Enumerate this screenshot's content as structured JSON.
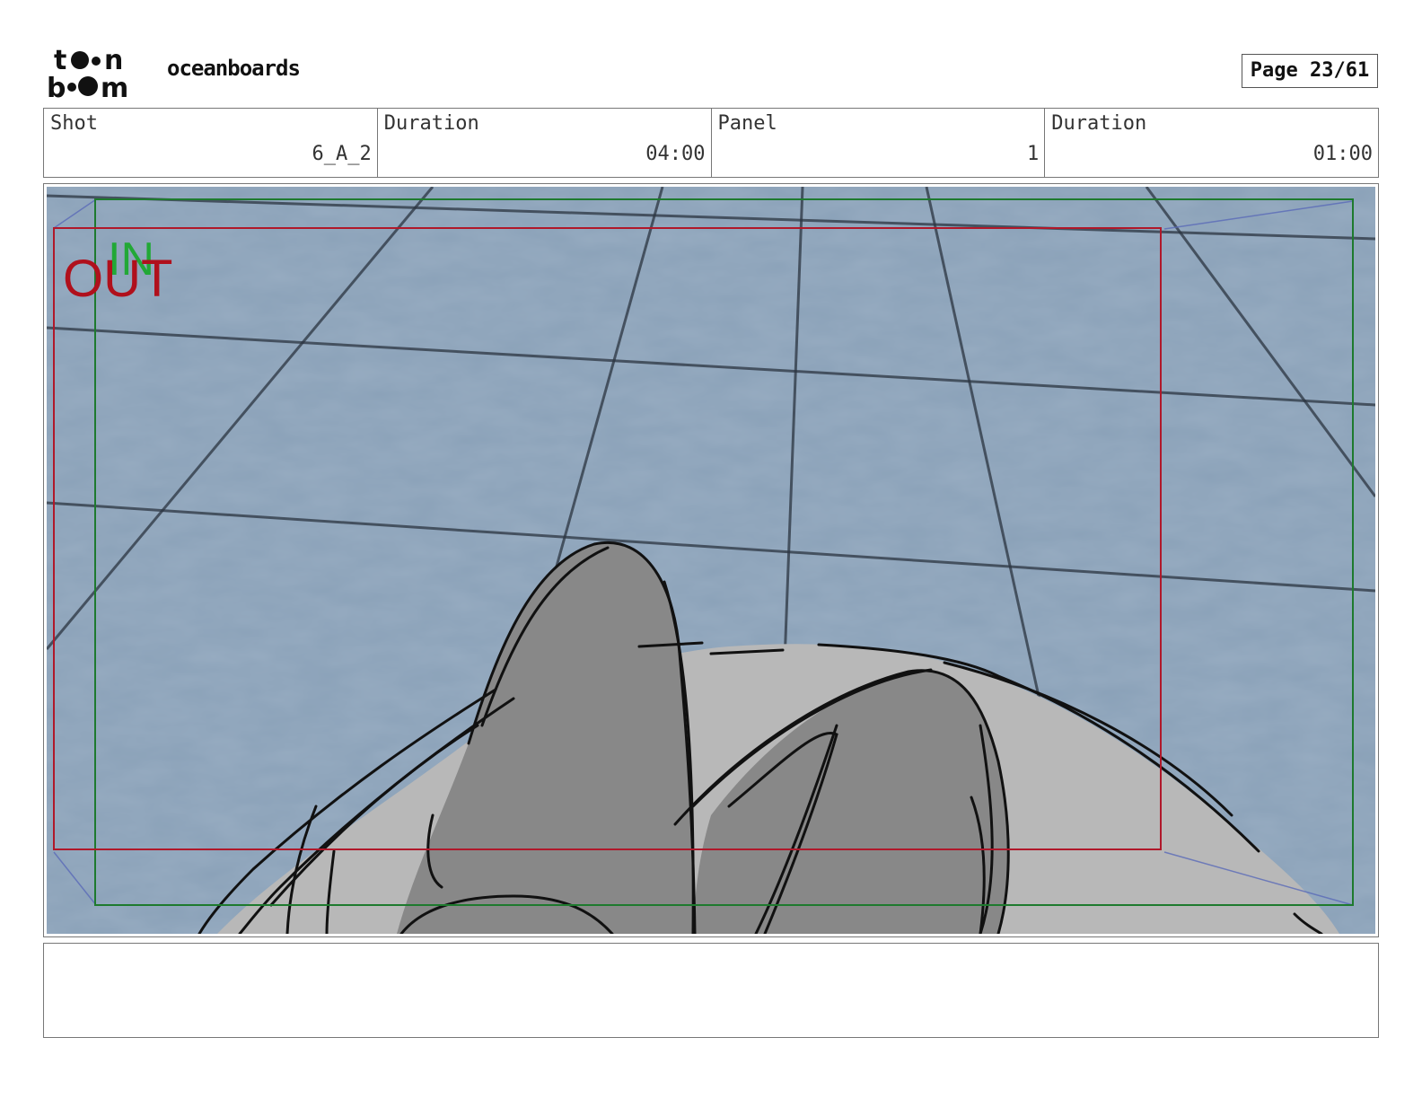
{
  "header": {
    "logo_text": "toonboom",
    "project_name": "oceanboards",
    "page_label": "Page 23/61"
  },
  "info": {
    "shot": {
      "label": "Shot",
      "value": "6_A_2"
    },
    "shot_duration": {
      "label": "Duration",
      "value": "04:00"
    },
    "panel": {
      "label": "Panel",
      "value": "1"
    },
    "panel_duration": {
      "label": "Duration",
      "value": "01:00"
    }
  },
  "panel_image": {
    "in_marker": "IN",
    "out_marker": "OUT",
    "colors": {
      "water": "#7f97b0",
      "grid": "#2b3440",
      "in_frame": "#1e7a2e",
      "out_frame": "#b0182a",
      "sketch_dark": "#8a8a8a",
      "sketch_light": "#b8b8b8",
      "ink": "#111111"
    }
  },
  "notes": {
    "text": ""
  }
}
